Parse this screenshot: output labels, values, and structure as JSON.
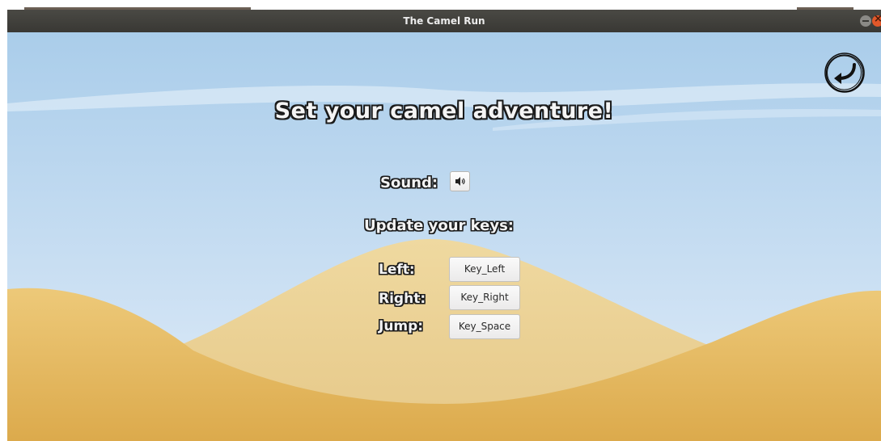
{
  "window": {
    "title": "The Camel Run",
    "controls": [
      "minimize-icon",
      "close-icon"
    ]
  },
  "settings": {
    "heading": "Set your camel adventure!",
    "sound_label": "Sound:",
    "sound_icon": "speaker-icon",
    "keys_heading": "Update your keys:",
    "keys": [
      {
        "label": "Left:",
        "value": "Key_Left"
      },
      {
        "label": "Right:",
        "value": "Key_Right"
      },
      {
        "label": "Jump:",
        "value": "Key_Space"
      }
    ],
    "back_icon": "back-arrow-icon"
  },
  "colors": {
    "sky_top": "#aecfeb",
    "sky_bottom": "#dbe9f7",
    "dune_front": "#e9bd64",
    "dune_back": "#ecd49a",
    "titlebar": "#3c3b37",
    "close_button": "#e2582a"
  }
}
